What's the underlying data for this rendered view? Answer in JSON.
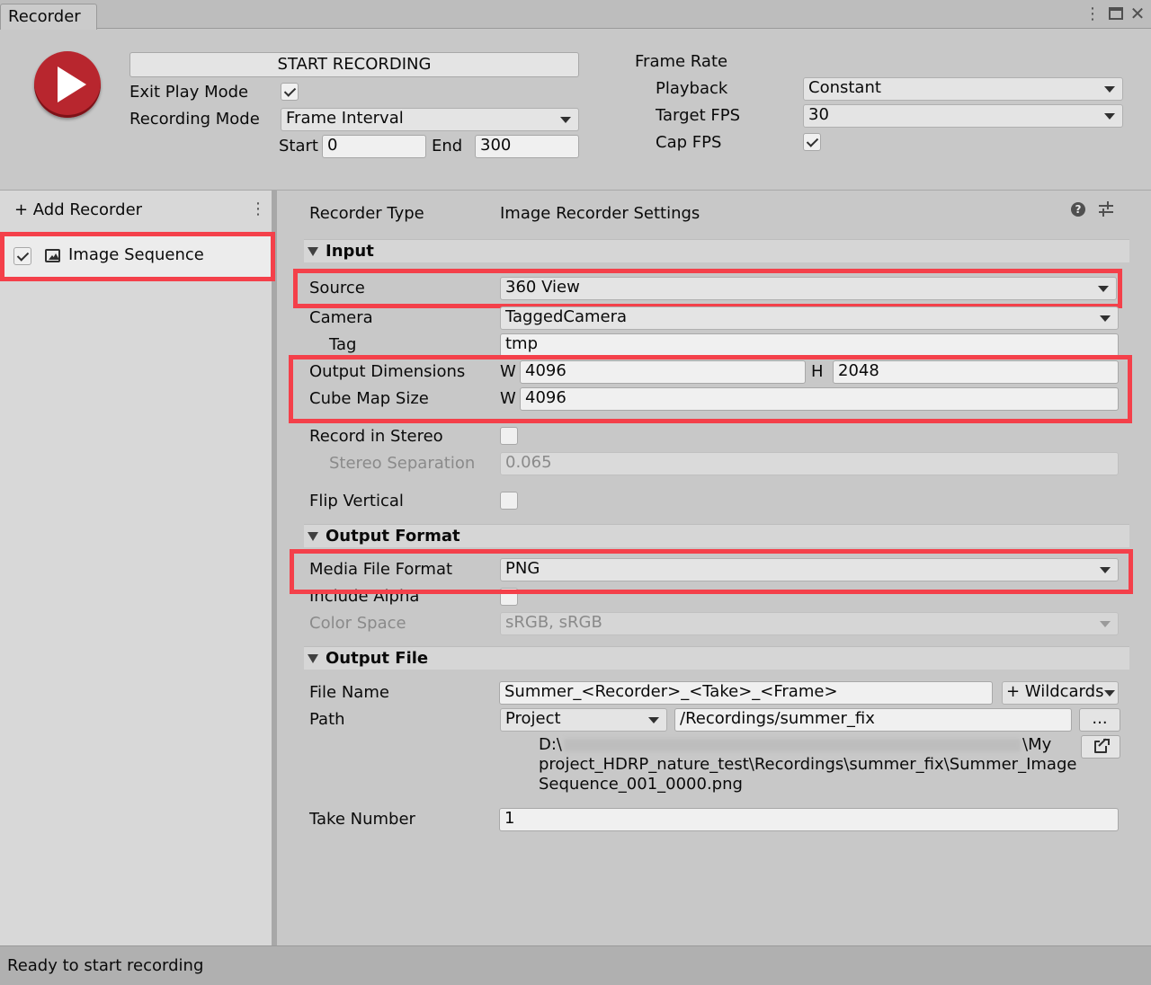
{
  "window": {
    "tab_title": "Recorder"
  },
  "top": {
    "start_recording_label": "START RECORDING",
    "exit_play_mode_label": "Exit Play Mode",
    "exit_play_mode_checked": true,
    "recording_mode_label": "Recording Mode",
    "recording_mode_value": "Frame Interval",
    "start_label": "Start",
    "start_value": "0",
    "end_label": "End",
    "end_value": "300",
    "frame_rate_label": "Frame Rate",
    "playback_label": "Playback",
    "playback_value": "Constant",
    "target_fps_label": "Target FPS",
    "target_fps_value": "30",
    "cap_fps_label": "Cap FPS",
    "cap_fps_checked": true
  },
  "sidebar": {
    "add_recorder_label": "+ Add Recorder",
    "items": [
      {
        "label": "Image Sequence",
        "checked": true
      }
    ]
  },
  "settings": {
    "recorder_type_label": "Recorder Type",
    "recorder_type_value": "Image Recorder Settings",
    "input_section": "Input",
    "source_label": "Source",
    "source_value": "360 View",
    "camera_label": "Camera",
    "camera_value": "TaggedCamera",
    "tag_label": "Tag",
    "tag_value": "tmp",
    "output_dimensions_label": "Output Dimensions",
    "w_label": "W",
    "h_label": "H",
    "output_w": "4096",
    "output_h": "2048",
    "cube_map_label": "Cube Map Size",
    "cube_map_w": "4096",
    "record_stereo_label": "Record in Stereo",
    "stereo_separation_label": "Stereo Separation",
    "stereo_separation_value": "0.065",
    "flip_vertical_label": "Flip Vertical",
    "output_format_section": "Output Format",
    "media_format_label": "Media File Format",
    "media_format_value": "PNG",
    "include_alpha_label": "Include Alpha",
    "color_space_label": "Color Space",
    "color_space_value": "sRGB, sRGB",
    "output_file_section": "Output File",
    "file_name_label": "File Name",
    "file_name_value": "Summer_<Recorder>_<Take>_<Frame>",
    "wildcards_label": "+ Wildcards",
    "path_label": "Path",
    "path_root_value": "Project",
    "path_value": "/Recordings/summer_fix",
    "browse_label": "...",
    "resolved_path_line1_start": "D:\\",
    "resolved_path_line1_end": "\\My",
    "resolved_path_line2": "project_HDRP_nature_test\\Recordings\\summer_fix\\Summer_Image",
    "resolved_path_line3": "Sequence_001_0000.png",
    "take_number_label": "Take Number",
    "take_number_value": "1"
  },
  "status": {
    "text": "Ready to start recording"
  },
  "colors": {
    "highlight": "#f4404a",
    "record_button": "#b8262e"
  }
}
